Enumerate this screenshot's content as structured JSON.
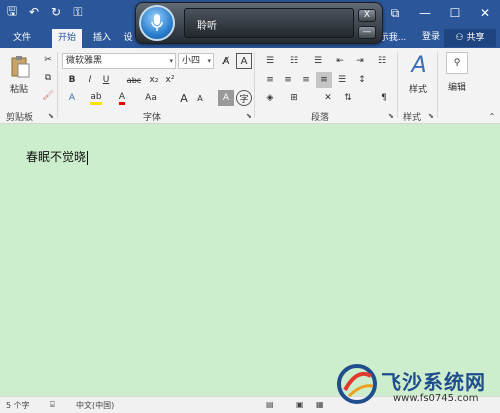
{
  "qat": {
    "items": [
      {
        "icon": "save-icon",
        "glyph": "🖫"
      },
      {
        "icon": "undo-icon",
        "glyph": "↶"
      },
      {
        "icon": "redo-icon",
        "glyph": "↻"
      },
      {
        "icon": "structure-icon",
        "glyph": "⚿"
      }
    ]
  },
  "window_buttons": {
    "restore": "⧉",
    "minimize": "—",
    "maximize": "☐",
    "close": "✕"
  },
  "tabs": {
    "file": "文件",
    "home": "开始",
    "insert": "插入",
    "design_fragment": "设",
    "review_fragment": "示我...",
    "login": "登录",
    "share": "共享"
  },
  "ribbon": {
    "clipboard": {
      "paste_label": "粘贴",
      "group_label": "剪贴板"
    },
    "font": {
      "font_name": "微软雅黑",
      "font_size": "小四",
      "bold": "B",
      "italic": "I",
      "underline": "U",
      "strike": "abc",
      "subscript": "x₂",
      "superscript": "x²",
      "aa_change": "Aa",
      "group_label": "字体"
    },
    "paragraph": {
      "group_label": "段落"
    },
    "styles": {
      "styles_label": "样式",
      "group_label": "样式"
    },
    "editing": {
      "editing_label": "编辑"
    }
  },
  "speech": {
    "status_text": "聆听",
    "close_btn": "X",
    "minimize_btn": "—"
  },
  "document": {
    "text": "春眠不觉晓"
  },
  "status": {
    "word_count": "5 个字",
    "language": "中文(中国)"
  },
  "watermark": {
    "brand": "飞沙系统网",
    "url": "www.fs0745.com"
  },
  "colors": {
    "word_blue": "#2b579a",
    "doc_background": "#cceecc",
    "ribbon_bg": "#f3f3f3"
  }
}
